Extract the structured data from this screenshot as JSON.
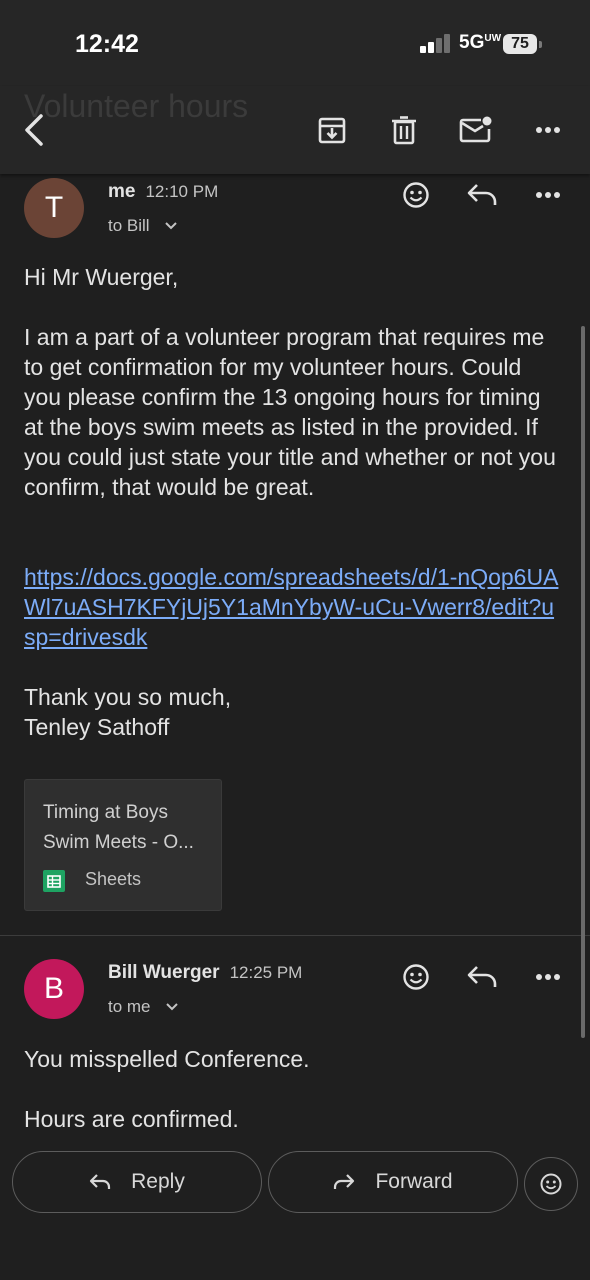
{
  "status": {
    "time": "12:42",
    "network": "5G",
    "network_sub": "UW",
    "battery": "75"
  },
  "toolbar": {
    "ghost_title": "Volunteer hours"
  },
  "message1": {
    "avatar_letter": "T",
    "avatar_color": "#6b4436",
    "sender": "me",
    "time": "12:10 PM",
    "recipient": "to Bill",
    "greeting": "Hi Mr Wuerger,",
    "paragraph": "I am a part of a volunteer program that requires me to get confirmation for my volunteer hours. Could you please confirm the 13 ongoing hours for timing at the boys swim meets as listed in the provided. If you could just state your title and whether or not you confirm, that would be great.",
    "link": "https://docs.google.com/spreadsheets/d/1-nQop6UAWl7uASH7KFYjUj5Y1aMnYbyW-uCu-Vwerr8/edit?usp=drivesdk",
    "signoff": "Thank you so much,\nTenley Sathoff",
    "attachment": {
      "title": "Timing at Boys Swim Meets - O...",
      "app": "Sheets"
    }
  },
  "message2": {
    "avatar_letter": "B",
    "avatar_color": "#c2185b",
    "sender": "Bill Wuerger",
    "time": "12:25 PM",
    "recipient": "to me",
    "line1": "You misspelled Conference.",
    "line2": "Hours are confirmed."
  },
  "actions": {
    "reply": "Reply",
    "forward": "Forward"
  }
}
